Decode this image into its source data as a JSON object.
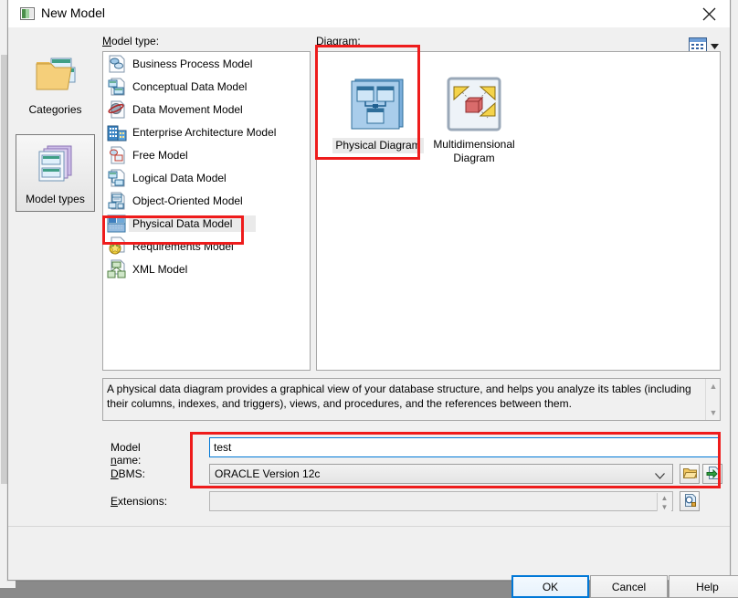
{
  "window": {
    "title": "New Model",
    "title_icon": "model-window-icon",
    "close_icon": "close-icon"
  },
  "toolbar": {
    "viewmode_icon": "list-view-icon",
    "viewmode_caret": "chevron-down-icon"
  },
  "leftrail": {
    "items": [
      {
        "label": "Categories",
        "icon": "folder-categories-icon",
        "selected": false
      },
      {
        "label": "Model types",
        "icon": "model-types-icon",
        "selected": true
      }
    ]
  },
  "modeltype": {
    "label": "Model type:",
    "label_accel": "M",
    "items": [
      {
        "label": "Business Process Model",
        "icon": "business-process-model-icon",
        "selected": false
      },
      {
        "label": "Conceptual Data Model",
        "icon": "conceptual-data-model-icon",
        "selected": false
      },
      {
        "label": "Data Movement Model",
        "icon": "data-movement-model-icon",
        "selected": false
      },
      {
        "label": "Enterprise Architecture Model",
        "icon": "enterprise-architecture-model-icon",
        "selected": false
      },
      {
        "label": "Free Model",
        "icon": "free-model-icon",
        "selected": false
      },
      {
        "label": "Logical Data Model",
        "icon": "logical-data-model-icon",
        "selected": false
      },
      {
        "label": "Object-Oriented Model",
        "icon": "object-oriented-model-icon",
        "selected": false
      },
      {
        "label": "Physical Data Model",
        "icon": "physical-data-model-icon",
        "selected": true
      },
      {
        "label": "Requirements Model",
        "icon": "requirements-model-icon",
        "selected": false
      },
      {
        "label": "XML Model",
        "icon": "xml-model-icon",
        "selected": false
      }
    ]
  },
  "diagram": {
    "label": "Diagram:",
    "label_accel": "D",
    "items": [
      {
        "label": "Physical Diagram",
        "icon": "physical-diagram-icon",
        "selected": true
      },
      {
        "label": "Multidimensional Diagram",
        "icon": "multidimensional-diagram-icon",
        "selected": false
      }
    ]
  },
  "description": {
    "text": "A physical data diagram provides a graphical view of your database structure, and helps you analyze its tables (including their columns, indexes, and triggers), views, and procedures, and the references between them.",
    "scroll_up_icon": "scroll-up-arrow-icon",
    "scroll_down_icon": "scroll-down-arrow-icon"
  },
  "form": {
    "model_name": {
      "label": "Model name:",
      "label_accel": "n",
      "value": "test",
      "placeholder": ""
    },
    "dbms": {
      "label": "DBMS:",
      "label_accel": "D",
      "value": "ORACLE Version 12c",
      "caret_icon": "chevron-down-icon",
      "browse_icon": "folder-open-icon",
      "share_icon": "link-to-file-icon"
    },
    "extensions": {
      "label": "Extensions:",
      "label_accel": "E",
      "value": "",
      "spin_up_icon": "spinner-up-icon",
      "spin_down_icon": "spinner-down-icon",
      "select_icon": "magnifier-properties-icon"
    }
  },
  "footer": {
    "ok": "OK",
    "cancel": "Cancel",
    "help": "Help"
  },
  "annotations": {
    "color": "#ee1c1c",
    "boxes": [
      {
        "name": "highlight-diagram-physical"
      },
      {
        "name": "highlight-physical-data-model"
      },
      {
        "name": "highlight-name-and-dbms"
      }
    ]
  }
}
